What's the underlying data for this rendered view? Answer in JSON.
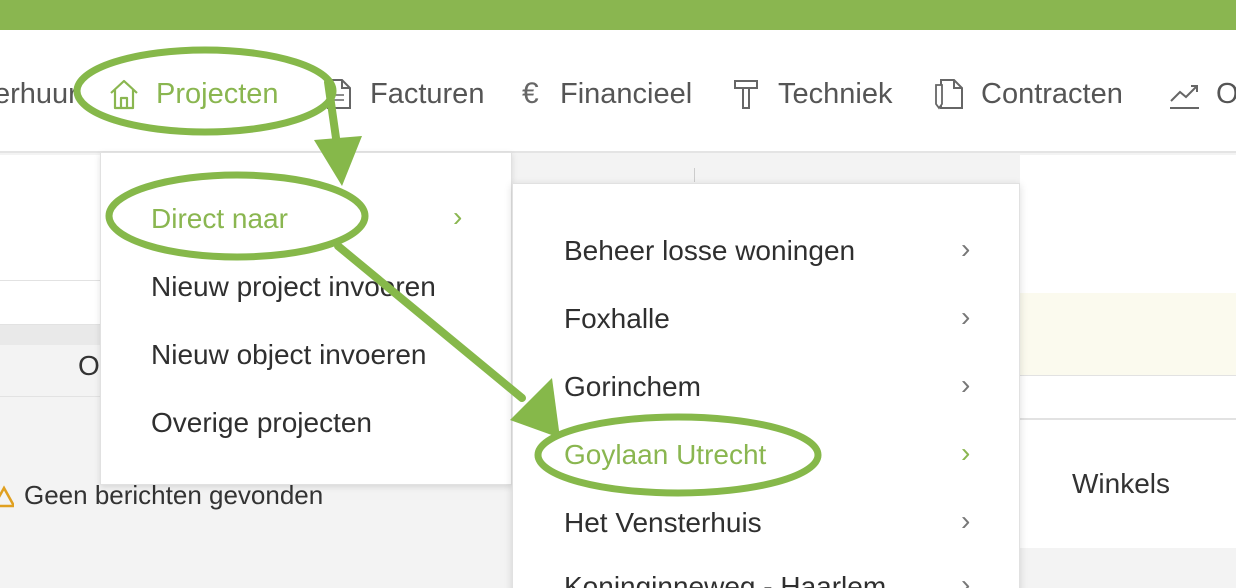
{
  "nav": {
    "items": [
      {
        "label": "erhuur",
        "icon": "none"
      },
      {
        "label": "Projecten",
        "icon": "home-icon"
      },
      {
        "label": "Facturen",
        "icon": "document-icon"
      },
      {
        "label": "Financieel",
        "icon": "euro-icon",
        "glyph": "€"
      },
      {
        "label": "Techniek",
        "icon": "hammer-icon"
      },
      {
        "label": "Contracten",
        "icon": "contract-icon"
      },
      {
        "label": "O",
        "icon": "chart-trend-icon"
      }
    ],
    "active": "Projecten"
  },
  "projects_menu": {
    "items": [
      {
        "label": "Direct naar",
        "has_submenu": true,
        "active": true
      },
      {
        "label": "Nieuw project invoeren"
      },
      {
        "label": "Nieuw object invoeren"
      },
      {
        "label": "Overige projecten"
      }
    ]
  },
  "direct_menu": {
    "items": [
      {
        "label": "Beheer losse woningen"
      },
      {
        "label": "Foxhalle"
      },
      {
        "label": "Gorinchem"
      },
      {
        "label": "Goylaan Utrecht",
        "active": true
      },
      {
        "label": "Het Vensterhuis"
      },
      {
        "label": "Koninginneweg - Haarlem"
      }
    ],
    "chevron": "›"
  },
  "background": {
    "column_label": "O",
    "notice": "Geen berichten gevonden",
    "right_label": "Winkels"
  },
  "colors": {
    "brand_green": "#8ab650",
    "annotation_green": "#86b84a",
    "text": "#2f2f2f"
  }
}
